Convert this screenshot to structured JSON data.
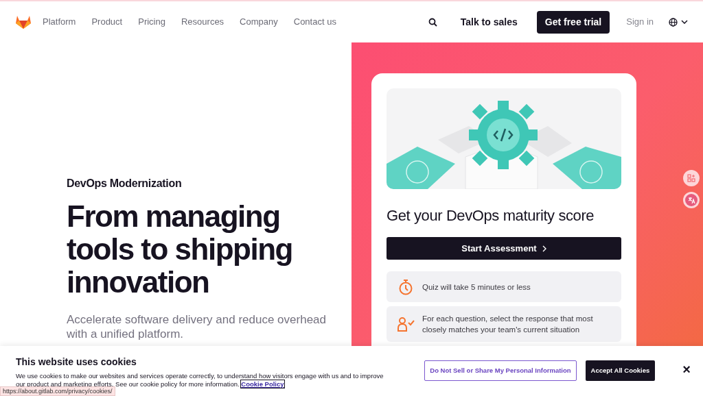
{
  "nav": {
    "links": [
      "Platform",
      "Product",
      "Pricing",
      "Resources",
      "Company",
      "Contact us"
    ],
    "talk_to_sales": "Talk to sales",
    "trial_button": "Get free trial",
    "sign_in": "Sign in"
  },
  "hero": {
    "eyebrow": "DevOps Modernization",
    "headline": "From managing tools to shipping innovation",
    "subtext": "Accelerate software delivery and reduce overhead with a unified platform."
  },
  "assessment_card": {
    "title": "Get your DevOps maturity score",
    "button": "Start Assessment",
    "info_items": [
      {
        "kind": "timer",
        "text": "Quiz will take 5 minutes or less"
      },
      {
        "kind": "person-check",
        "text": "For each question, select the response that most closely matches your team's current situation"
      }
    ]
  },
  "cookie_banner": {
    "title": "This website uses cookies",
    "text": "We use cookies to make our websites and services operate correctly, to understand how visitors engage with us and to improve our product and marketing efforts. See our cookie policy for more information.",
    "policy_link": "Cookie Policy",
    "do_not_sell_button": "Do Not Sell or Share My Personal Information",
    "accept_button": "Accept All Cookies",
    "close": "×"
  },
  "status_url": "https://about.gitlab.com/privacy/cookies/"
}
